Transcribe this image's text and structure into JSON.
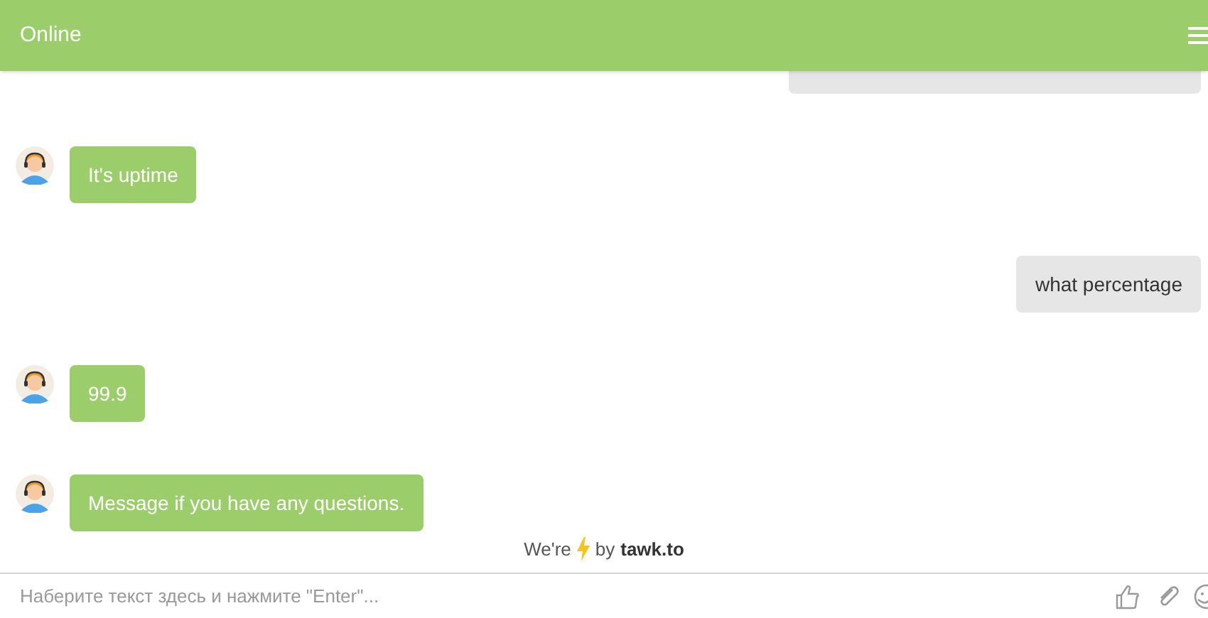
{
  "header": {
    "title": "Online"
  },
  "messages": [
    {
      "kind": "visitor"
    },
    {
      "kind": "agent",
      "text": "It's uptime"
    },
    {
      "kind": "visitor",
      "text": "what percentage"
    },
    {
      "kind": "agent",
      "text": "99.9"
    },
    {
      "kind": "agent",
      "text": "Message if you have any questions."
    }
  ],
  "branding": {
    "prefix": "We're",
    "middle": "by",
    "brand": "tawk.to"
  },
  "composer": {
    "placeholder": "Наберите текст здесь и нажмите \"Enter\"..."
  }
}
